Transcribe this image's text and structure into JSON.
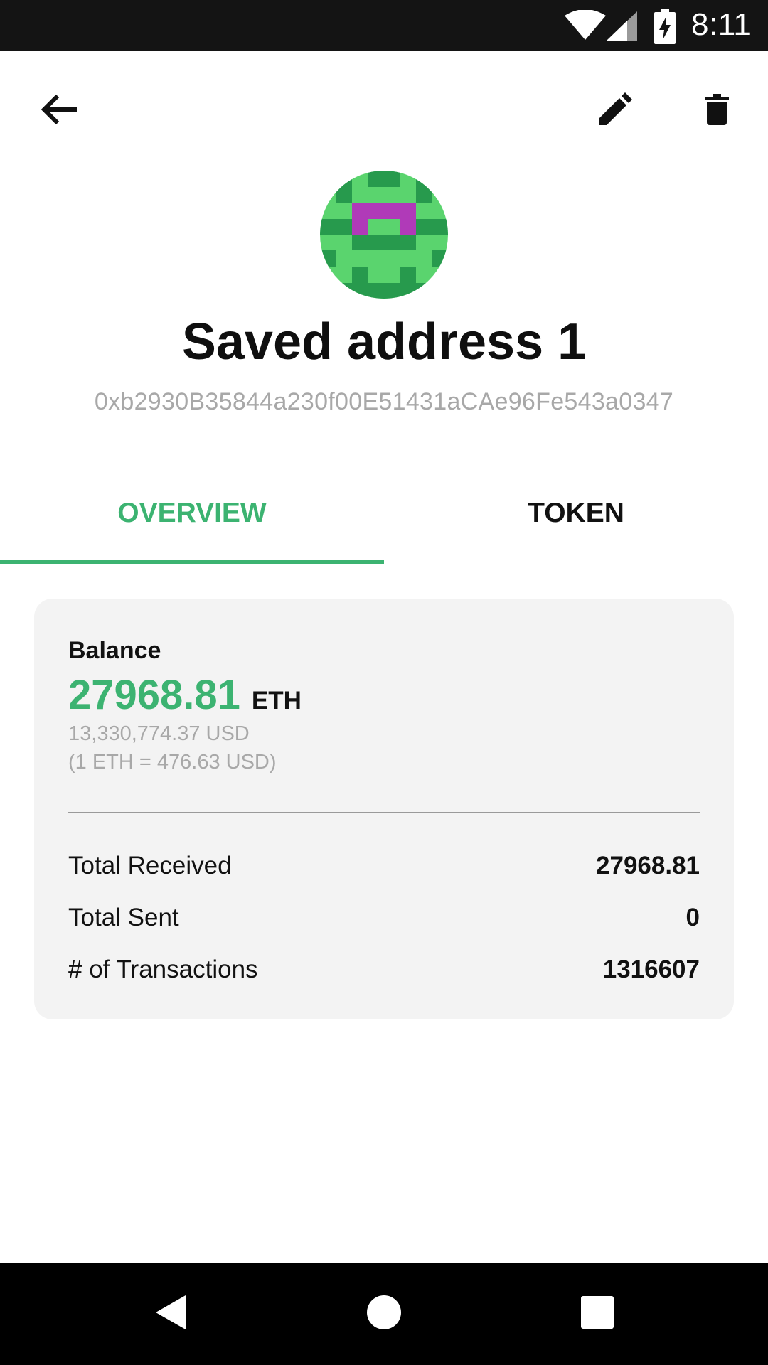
{
  "status_bar": {
    "time": "8:11",
    "icons": [
      "wifi-icon",
      "signal-icon",
      "battery-charging-icon"
    ]
  },
  "toolbar": {
    "back_icon": "arrow-back-icon",
    "edit_icon": "pencil-icon",
    "delete_icon": "trash-icon"
  },
  "header": {
    "title": "Saved address 1",
    "address": "0xb2930B35844a230f00E51431aCAe96Fe543a0347"
  },
  "tabs": [
    {
      "label": "OVERVIEW",
      "active": true
    },
    {
      "label": "TOKEN",
      "active": false
    }
  ],
  "colors": {
    "accent": "#3cb371",
    "identicon_dark": "#279a4d",
    "identicon_light": "#5ad46e",
    "identicon_magenta": "#b03ab8"
  },
  "card": {
    "balance_label": "Balance",
    "balance_value": "27968.81",
    "balance_unit": "ETH",
    "balance_usd": "13,330,774.37 USD",
    "rate": "(1 ETH = 476.63 USD)",
    "stats": [
      {
        "label": "Total Received",
        "value": "27968.81"
      },
      {
        "label": "Total Sent",
        "value": "0"
      },
      {
        "label": "# of Transactions",
        "value": "1316607"
      }
    ]
  },
  "nav_bar": {
    "icons": [
      "nav-back-icon",
      "nav-home-icon",
      "nav-recent-icon"
    ]
  }
}
